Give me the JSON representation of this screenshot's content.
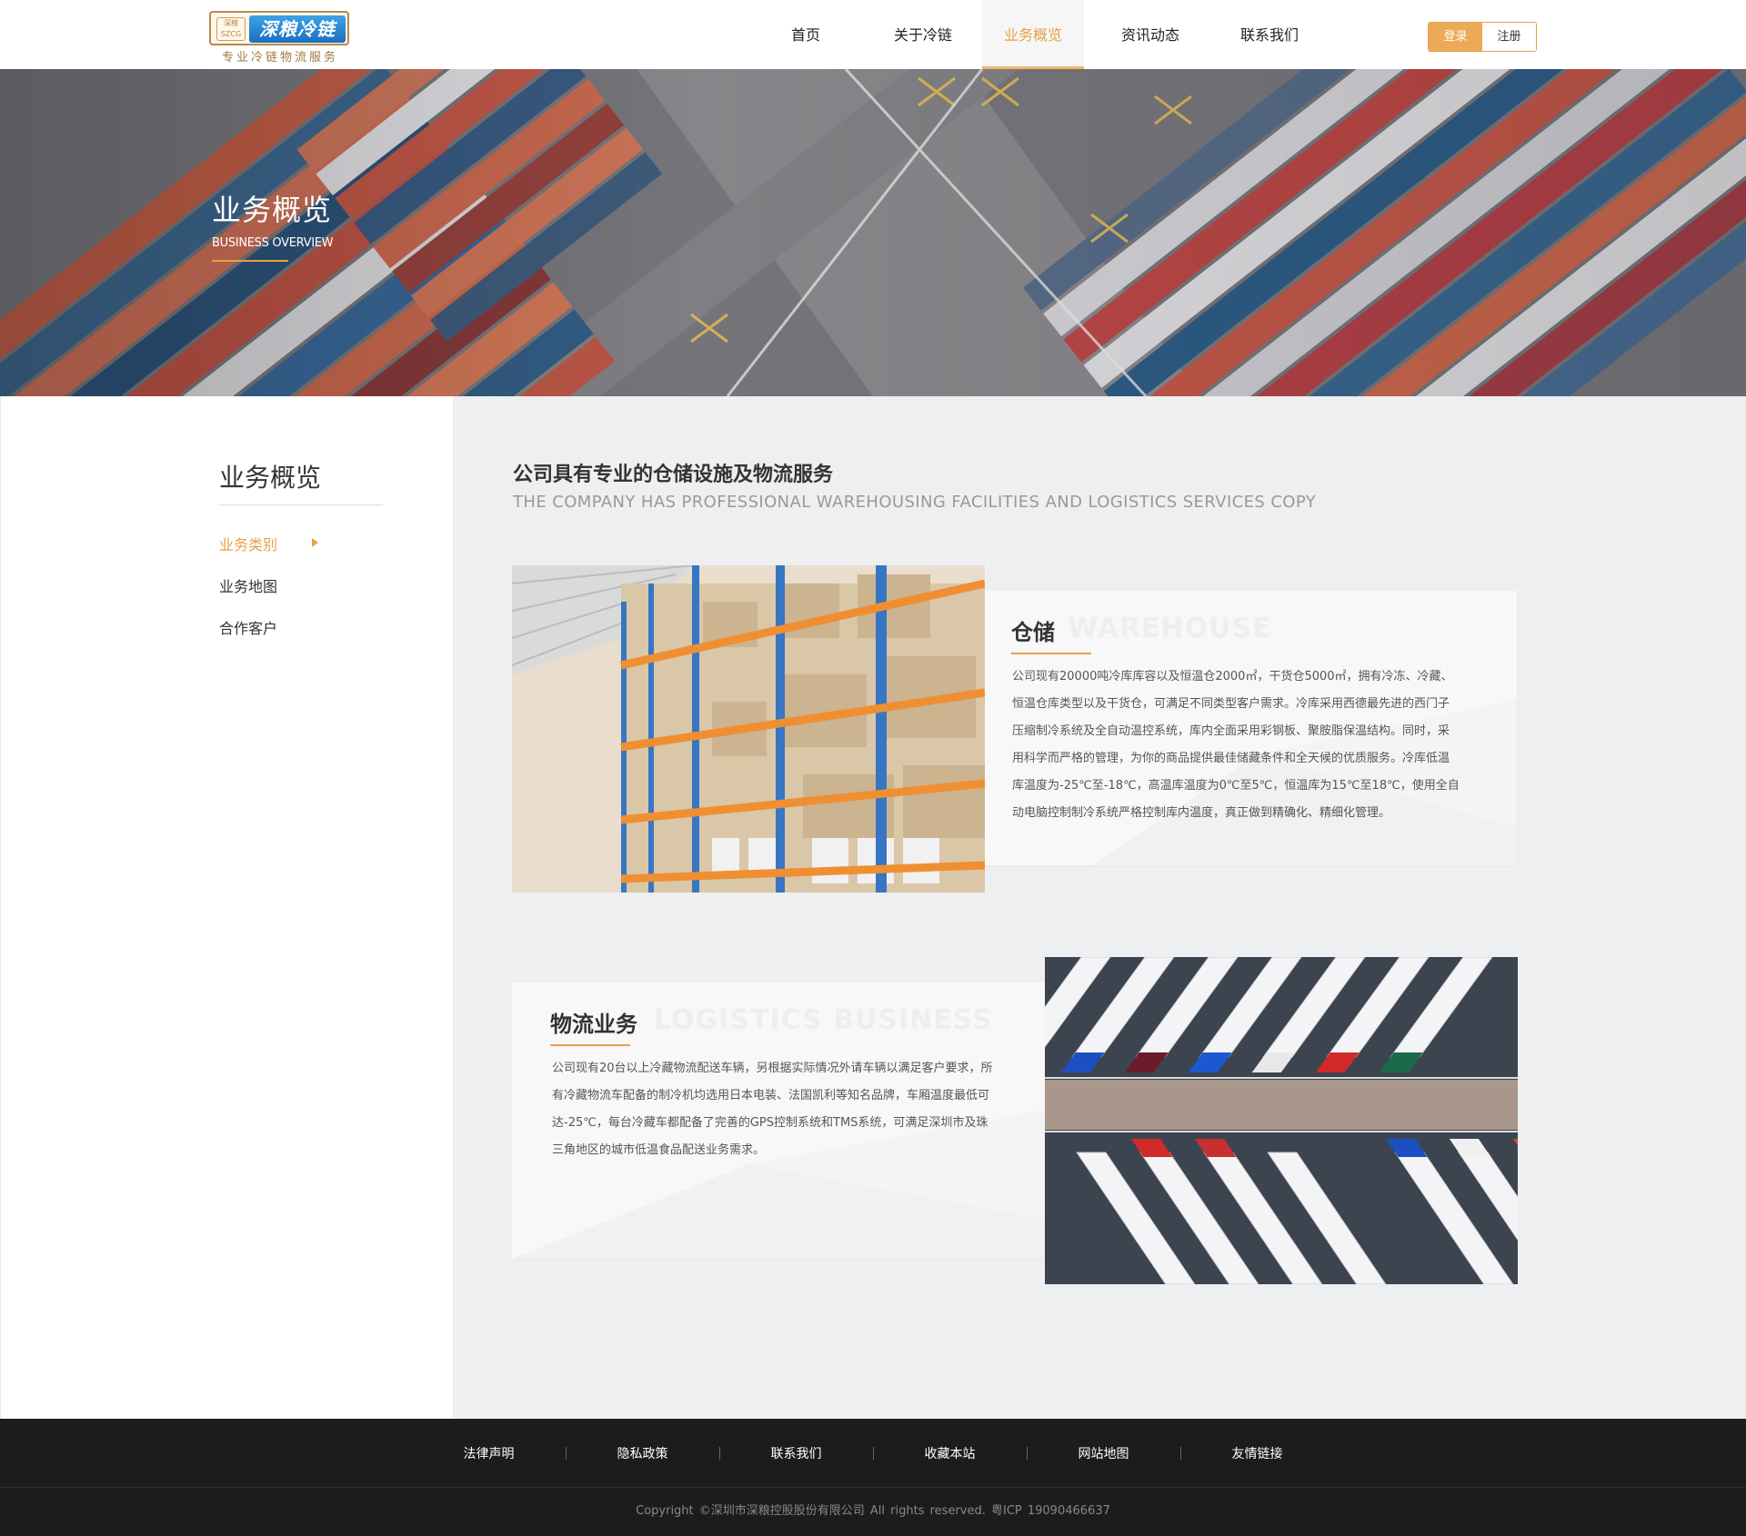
{
  "header": {
    "logo": {
      "seal_text_top": "深粮",
      "seal_text_bottom": "SZCG",
      "name": "深粮冷链",
      "tagline": "专业冷链物流服务"
    },
    "nav": [
      {
        "label": "首页",
        "active": false
      },
      {
        "label": "关于冷链",
        "active": false
      },
      {
        "label": "业务概览",
        "active": true
      },
      {
        "label": "资讯动态",
        "active": false
      },
      {
        "label": "联系我们",
        "active": false
      }
    ],
    "auth": {
      "login": "登录",
      "register": "注册"
    }
  },
  "banner": {
    "title": "业务概览",
    "subtitle": "BUSINESS OVERVIEW",
    "image": "aerial-container-port-photo"
  },
  "sidebar": {
    "title": "业务概览",
    "items": [
      {
        "label": "业务类别",
        "active": true
      },
      {
        "label": "业务地图",
        "active": false
      },
      {
        "label": "合作客户",
        "active": false
      }
    ]
  },
  "main": {
    "title": "公司具有专业的仓储设施及物流服务",
    "subtitle": "THE COMPANY HAS PROFESSIONAL WAREHOUSING FACILITIES AND LOGISTICS SERVICES COPY",
    "sections": [
      {
        "heading": "仓储",
        "watermark": "WAREHOUSE",
        "image": "warehouse-shelves-photo",
        "lines": [
          "公司现有20000吨冷库库容以及恒温仓2000㎡，干货仓5000㎡，拥有冷冻、冷藏、",
          "恒温仓库类型以及干货仓，可满足不同类型客户需求。冷库采用西德最先进的西门子",
          "压缩制冷系统及全自动温控系统，库内全面采用彩钢板、聚胺脂保温结构。同时，采",
          "用科学而严格的管理，为你的商品提供最佳储藏条件和全天候的优质服务。冷库低温",
          "库温度为-25℃至-18℃，高温库温度为0℃至5℃，恒温库为15℃至18℃，使用全自",
          "动电脑控制制冷系统严格控制库内温度，真正做到精确化、精细化管理。"
        ]
      },
      {
        "heading": "物流业务",
        "watermark": "LOGISTICS BUSINESS",
        "image": "aerial-trucks-photo",
        "lines": [
          "公司现有20台以上冷藏物流配送车辆，另根据实际情况外请车辆以满足客户要求，所",
          "有冷藏物流车配备的制冷机均选用日本电装、法国凯利等知名品牌，车厢温度最低可",
          "达-25℃，每台冷藏车都配备了完善的GPS控制系统和TMS系统，可满足深圳市及珠",
          "三角地区的城市低温食品配送业务需求。"
        ]
      }
    ]
  },
  "footer": {
    "links": [
      "法律声明",
      "隐私政策",
      "联系我们",
      "收藏本站",
      "网站地图",
      "友情链接"
    ],
    "copyright": "Copyright ©深圳市深粮控股股份有限公司 All rights reserved. 粤ICP 19090466637"
  },
  "colors": {
    "accent": "#e8a04a",
    "footer_bg": "#1c1c1c",
    "main_bg": "#eeeff1"
  }
}
